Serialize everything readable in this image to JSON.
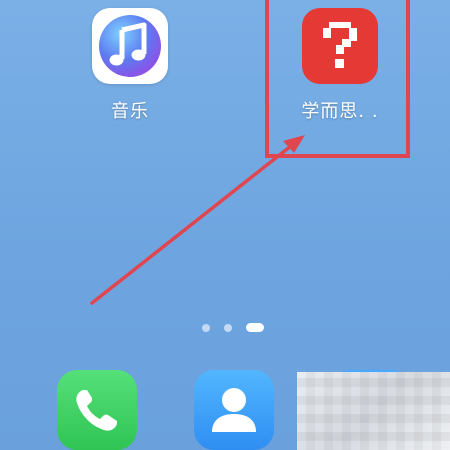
{
  "home_screen": {
    "apps": [
      {
        "label": "音乐",
        "icon": "music-note-icon"
      },
      {
        "label": "学而思. .",
        "icon": "question-mark-icon"
      }
    ],
    "page_indicator": {
      "pages": 3,
      "active_page": 3
    },
    "dock": [
      {
        "icon": "phone-icon"
      },
      {
        "icon": "contacts-icon"
      },
      {
        "icon": "app-icon"
      }
    ]
  },
  "annotation": {
    "color": "#e0464f",
    "target": "学而思. ."
  },
  "colors": {
    "wallpaper": "#6ea5e0",
    "xueersi_red": "#e53935",
    "phone_green": "#3ccf61",
    "contacts_blue": "#3a9cf8"
  }
}
